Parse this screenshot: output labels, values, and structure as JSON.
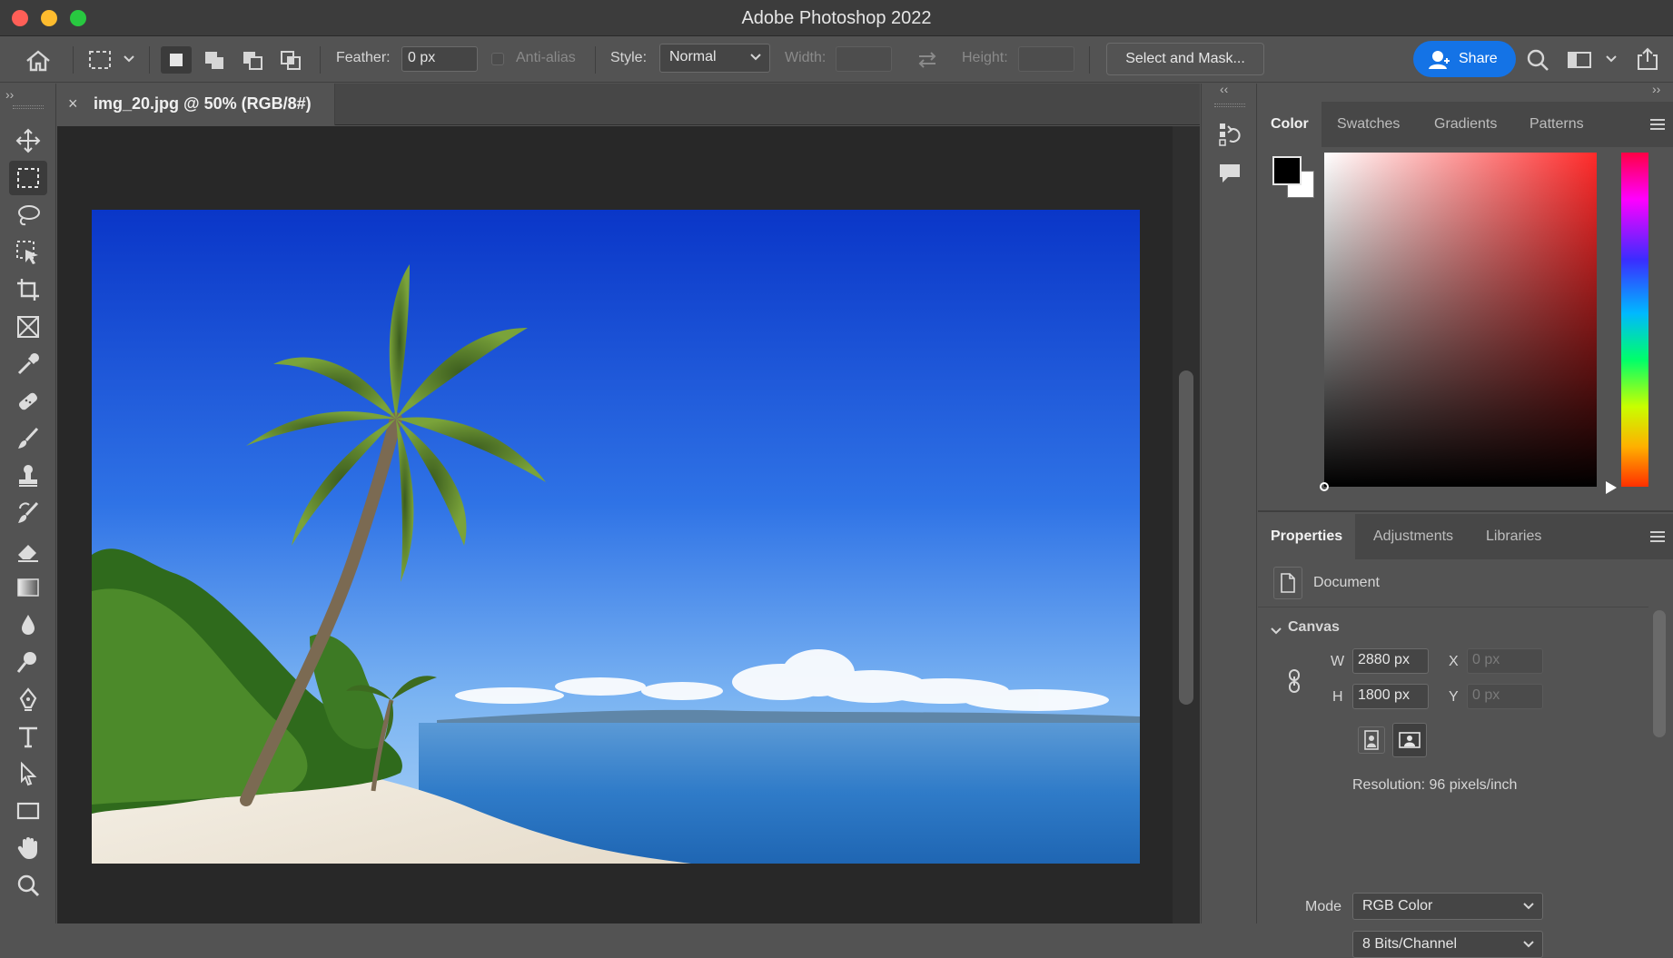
{
  "window": {
    "title": "Adobe Photoshop 2022"
  },
  "options_bar": {
    "feather_label": "Feather:",
    "feather_value": "0 px",
    "anti_alias_label": "Anti-alias",
    "style_label": "Style:",
    "style_value": "Normal",
    "width_label": "Width:",
    "height_label": "Height:",
    "select_and_mask_label": "Select and Mask...",
    "share_label": "Share"
  },
  "document": {
    "tab_label": "img_20.jpg @ 50% (RGB/8#)"
  },
  "color_panel": {
    "tabs": [
      "Color",
      "Swatches",
      "Gradients",
      "Patterns"
    ],
    "foreground": "#000000",
    "background": "#ffffff"
  },
  "properties_panel": {
    "tabs": [
      "Properties",
      "Adjustments",
      "Libraries"
    ],
    "document_label": "Document",
    "canvas_section": "Canvas",
    "w_label": "W",
    "w_value": "2880 px",
    "h_label": "H",
    "h_value": "1800 px",
    "x_label": "X",
    "x_placeholder": "0 px",
    "y_label": "Y",
    "y_placeholder": "0 px",
    "resolution": "Resolution: 96 pixels/inch",
    "mode_label": "Mode",
    "mode_value": "RGB Color",
    "bits_value": "8 Bits/Channel"
  },
  "colors": {
    "accent": "#1473e6",
    "panel": "#535353",
    "canvas": "#282828"
  }
}
